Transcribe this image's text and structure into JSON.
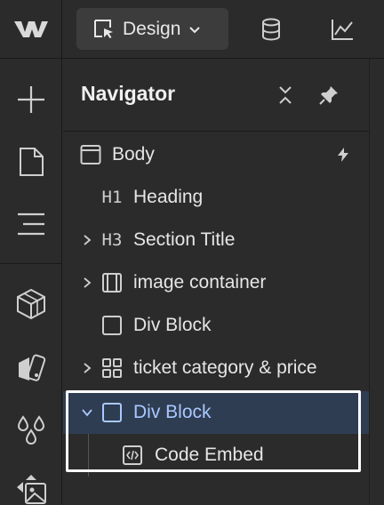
{
  "topbar": {
    "logo": "webflow-logo",
    "mode_label": "Design",
    "icons": [
      "cms-database-icon",
      "analytics-chart-icon"
    ]
  },
  "rail": {
    "icons": [
      "add-icon",
      "pages-icon",
      "navigator-icon",
      "components-icon",
      "style-selectors-icon",
      "variables-icon",
      "assets-icon"
    ]
  },
  "navigator": {
    "title": "Navigator",
    "items": [
      {
        "label": "Body",
        "icon": "body-icon",
        "badge": "lightning-icon"
      },
      {
        "label": "Heading",
        "icon": "H1"
      },
      {
        "label": "Section Title",
        "icon": "H3"
      },
      {
        "label": "image container",
        "icon": "container-icon"
      },
      {
        "label": "Div Block",
        "icon": "div-icon"
      },
      {
        "label": "ticket category & price",
        "icon": "grid-icon"
      },
      {
        "label": "Div Block",
        "icon": "div-icon",
        "selected": true
      },
      {
        "label": "Code Embed",
        "icon": "code-embed-icon"
      }
    ]
  },
  "colors": {
    "background": "#2b2b2b",
    "selected_row": "#2f3d52",
    "selected_text": "#a9c8ff",
    "highlight_border": "#ffffff"
  }
}
